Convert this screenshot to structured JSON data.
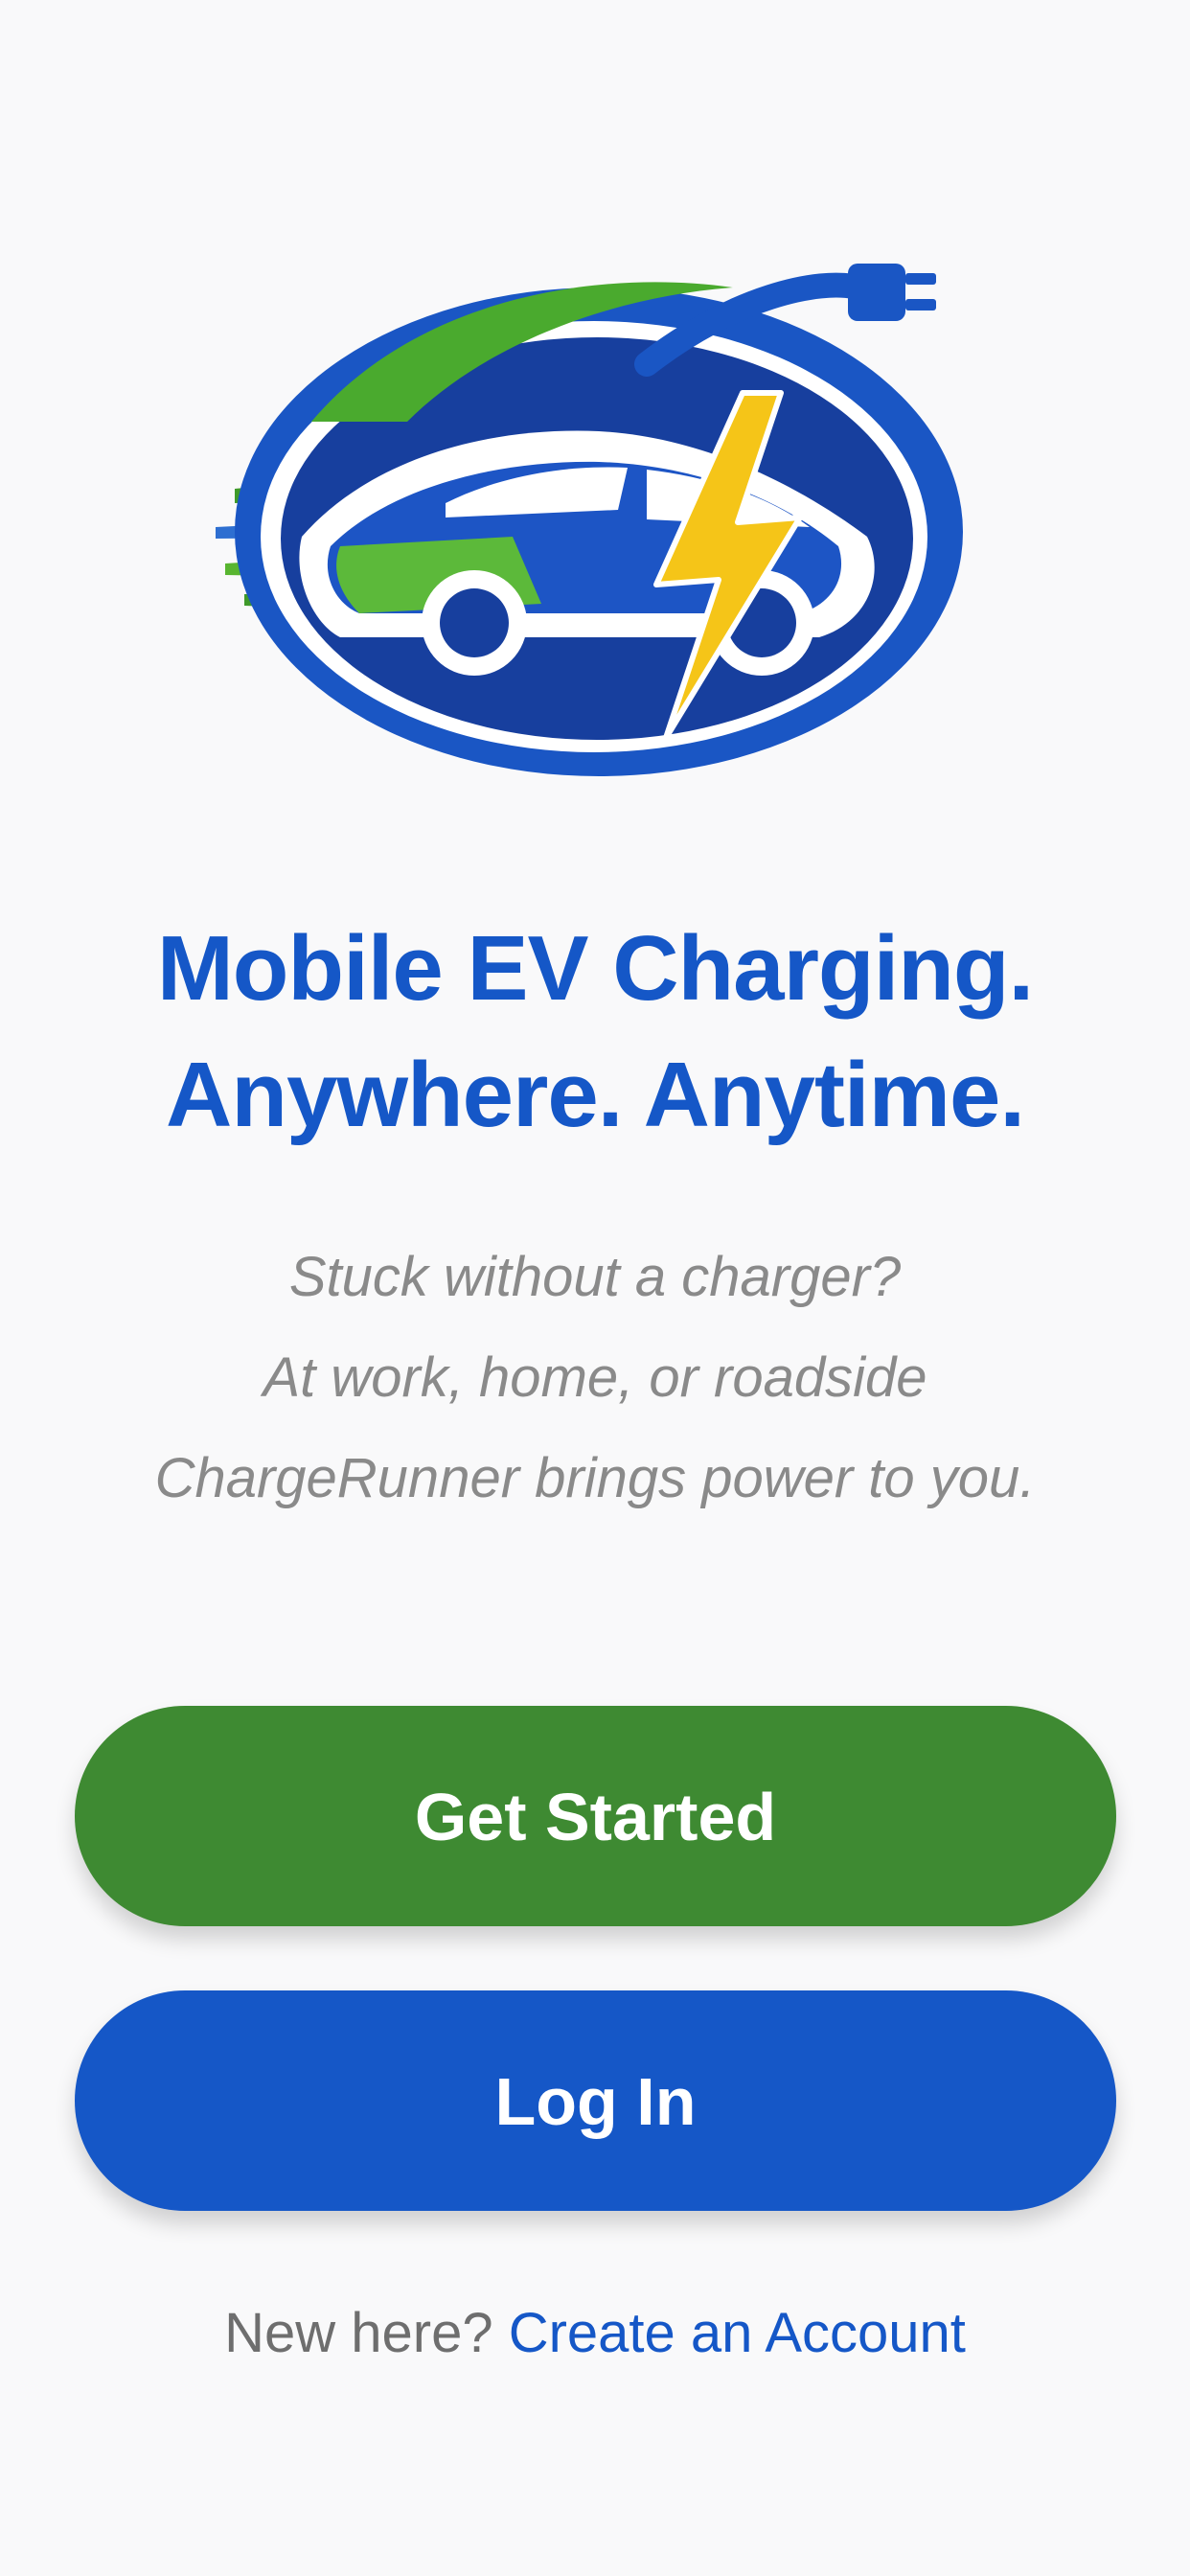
{
  "app": {
    "name": "ChargeRunner"
  },
  "colors": {
    "brand_blue": "#1557c7",
    "brand_green": "#3e8a32",
    "accent_yellow": "#f5c518",
    "background": "#f9f9fa"
  },
  "logo": {
    "icon": "ev-car-charging-logo"
  },
  "hero": {
    "headline_line1": "Mobile EV Charging.",
    "headline_line2": "Anywhere. Anytime."
  },
  "tagline": {
    "line1": "Stuck without a charger?",
    "line2": "At work, home, or roadside",
    "line3": "ChargeRunner brings power to you."
  },
  "actions": {
    "get_started_label": "Get Started",
    "login_label": "Log In"
  },
  "footer": {
    "prompt": "New here?",
    "create_account_label": "Create an Account"
  }
}
